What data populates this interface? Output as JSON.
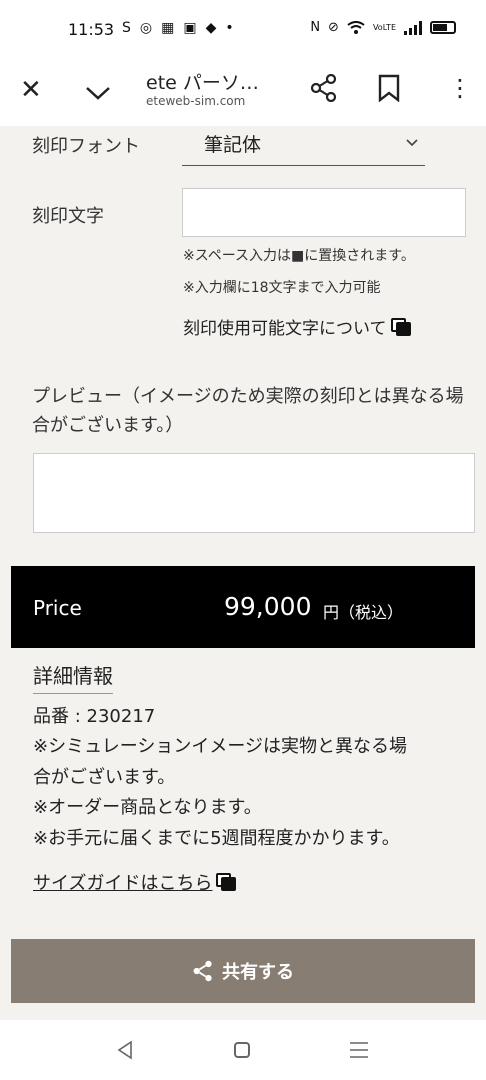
{
  "status_bar": {
    "time": "11:53",
    "left_icons": [
      "S",
      "◎",
      "▦",
      "▣",
      "◆",
      "•"
    ],
    "right_icons": [
      "N",
      "⊘",
      "wifi-icon",
      "VoLTE",
      "signal-icon",
      "battery-icon"
    ]
  },
  "browser": {
    "title": "ete パーソ…",
    "url": "eteweb-sim.com"
  },
  "form": {
    "font_label": "刻印フォント",
    "font_value": "筆記体",
    "engrave_label": "刻印文字",
    "engrave_value": "",
    "note_space": "※スペース入力は■に置換されます。",
    "note_limit": "※入力欄に18文字まで入力可能",
    "about_link": "刻印使用可能文字について",
    "preview_label": "プレビュー（イメージのため実際の刻印とは異なる場合がございます。）"
  },
  "price": {
    "label": "Price",
    "value": "99,000",
    "unit": "円（税込）"
  },
  "details": {
    "heading": "詳細情報",
    "lines": [
      "品番 : 230217",
      "※シミュレーションイメージは実物と異なる場",
      "合がございます。",
      "※オーダー商品となります。",
      "※お手元に届くまでに5週間程度かかります。"
    ],
    "size_guide": "サイズガイドはこちら"
  },
  "share_button": "共有する",
  "colors": {
    "background": "#f3f2ee",
    "price_bar": "#000000",
    "share_button": "#877d73"
  }
}
